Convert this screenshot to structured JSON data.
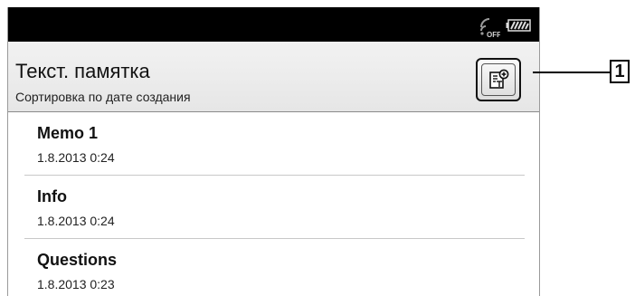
{
  "status_bar": {
    "wifi_icon": "wifi-off-icon",
    "wifi_state": "OFF",
    "battery_icon": "battery-icon"
  },
  "header": {
    "title": "Текст. памятка",
    "subtitle": "Сортировка по дате создания",
    "new_memo_icon": "new-text-memo-icon"
  },
  "memos": [
    {
      "title": "Memo 1",
      "date": "1.8.2013 0:24"
    },
    {
      "title": "Info",
      "date": "1.8.2013 0:24"
    },
    {
      "title": "Questions",
      "date": "1.8.2013 0:23"
    }
  ],
  "callout": {
    "label": "1"
  }
}
